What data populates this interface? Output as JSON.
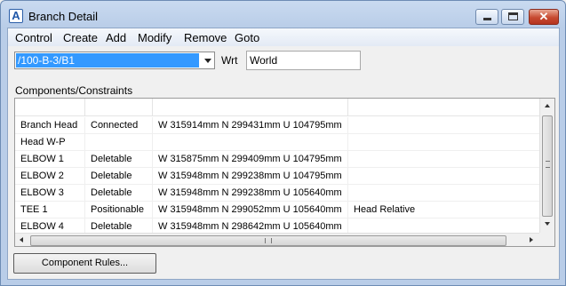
{
  "window": {
    "title": "Branch Detail"
  },
  "menu": [
    "Control",
    "Create",
    "Add",
    "Modify",
    "Remove",
    "Goto"
  ],
  "branch_select": {
    "value": "/100-B-3/B1"
  },
  "wrt": {
    "label": "Wrt",
    "value": "World"
  },
  "components": {
    "label": "Components/Constraints",
    "rows": [
      [
        "Branch Head",
        "Connected",
        "W 315914mm N 299431mm U 104795mm",
        ""
      ],
      [
        "Head W-P",
        "",
        "",
        ""
      ],
      [
        "ELBOW 1",
        "Deletable",
        "W 315875mm N 299409mm U 104795mm",
        ""
      ],
      [
        "ELBOW 2",
        "Deletable",
        "W 315948mm N 299238mm U 104795mm",
        ""
      ],
      [
        "ELBOW 3",
        "Deletable",
        "W 315948mm N 299238mm U 105640mm",
        ""
      ],
      [
        "TEE 1",
        "Positionable",
        "W 315948mm N 299052mm U 105640mm",
        "Head Relative"
      ],
      [
        "ELBOW 4",
        "Deletable",
        "W 315948mm N 298642mm U 105640mm",
        ""
      ]
    ]
  },
  "buttons": {
    "component_rules": "Component Rules..."
  }
}
